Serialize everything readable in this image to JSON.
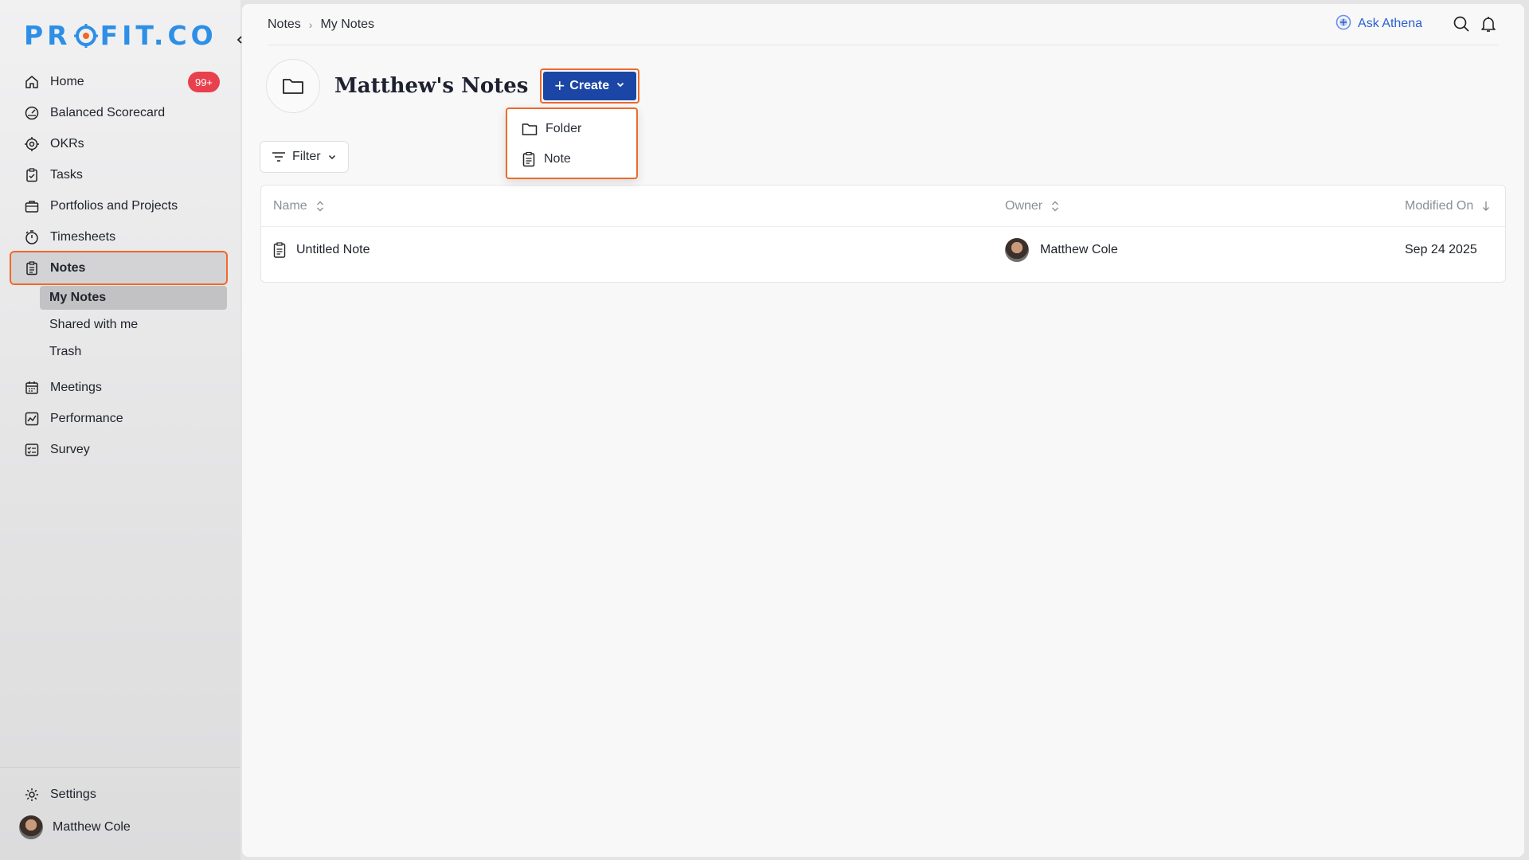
{
  "sidebar": {
    "logo": {
      "prefix": "PR",
      "suffix": "FIT.CO"
    },
    "items": [
      {
        "label": "Home",
        "icon": "home-icon",
        "badge": "99+"
      },
      {
        "label": "Balanced Scorecard",
        "icon": "scorecard-icon"
      },
      {
        "label": "OKRs",
        "icon": "target-icon"
      },
      {
        "label": "Tasks",
        "icon": "tasks-icon"
      },
      {
        "label": "Portfolios and Projects",
        "icon": "briefcase-icon"
      },
      {
        "label": "Timesheets",
        "icon": "stopwatch-icon"
      },
      {
        "label": "Notes",
        "icon": "notes-icon"
      }
    ],
    "sub_items": [
      {
        "label": "My Notes"
      },
      {
        "label": "Shared with me"
      },
      {
        "label": "Trash"
      }
    ],
    "items_after": [
      {
        "label": "Meetings",
        "icon": "calendar-icon"
      },
      {
        "label": "Performance",
        "icon": "performance-icon"
      },
      {
        "label": "Survey",
        "icon": "survey-icon"
      }
    ],
    "settings": {
      "label": "Settings",
      "icon": "gear-icon"
    },
    "user": {
      "name": "Matthew Cole"
    }
  },
  "topbar": {
    "breadcrumb": [
      "Notes",
      "My Notes"
    ],
    "ask_label": "Ask Athena"
  },
  "header": {
    "title": "Matthew's Notes",
    "create_label": "Create"
  },
  "create_menu": {
    "items": [
      {
        "label": "Folder",
        "icon": "folder-icon"
      },
      {
        "label": "Note",
        "icon": "note-icon"
      }
    ]
  },
  "filter": {
    "label": "Filter"
  },
  "table": {
    "columns": [
      "Name",
      "Owner",
      "Modified On"
    ],
    "rows": [
      {
        "name": "Untitled Note",
        "owner": "Matthew Cole",
        "modified": "Sep 24 2025"
      }
    ]
  },
  "colors": {
    "brand": "#2d8fe6",
    "primary_button": "#1c46a6",
    "highlight_outline": "#ee6a2a",
    "badge": "#e8404d",
    "ask_link": "#2b5fd0"
  }
}
